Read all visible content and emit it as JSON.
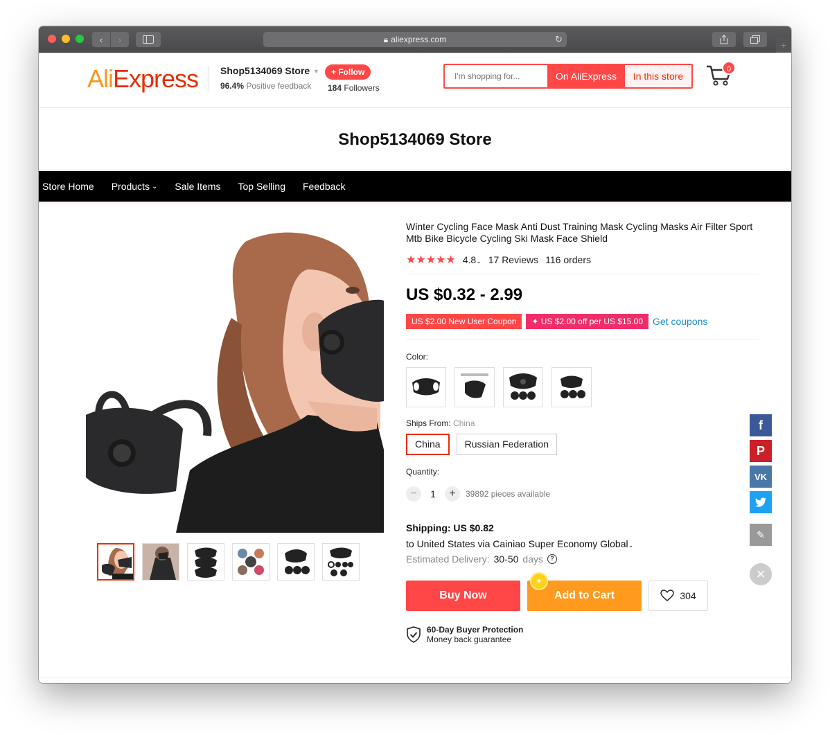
{
  "browser": {
    "url": "aliexpress.com"
  },
  "header": {
    "logo_ali": "Ali",
    "logo_express": "Express",
    "store_name": "Shop5134069 Store",
    "feedback_percent": "96.4%",
    "feedback_label": "Positive feedback",
    "follow_label": "+ Follow",
    "followers_count": "184",
    "followers_label": "Followers",
    "search_placeholder": "I'm shopping for...",
    "search_on_label": "On AliExpress",
    "search_store_label": "In this store",
    "cart_count": "0"
  },
  "banner": {
    "title": "Shop5134069 Store"
  },
  "store_nav": {
    "items": [
      "Store Home",
      "Products",
      "Sale Items",
      "Top Selling",
      "Feedback"
    ]
  },
  "product": {
    "title": "Winter Cycling Face Mask Anti Dust Training Mask Cycling Masks Air Filter Sport Mtb Bike Bicycle Cycling Ski Mask Face Shield",
    "stars": "★★★★★",
    "rating": "4.8",
    "reviews": "17 Reviews",
    "orders": "116 orders",
    "price": "US $0.32 - 2.99",
    "coupon_1": "US $2.00 New User Coupon",
    "coupon_2": "✦ US $2.00 off per US $15.00",
    "get_coupons": "Get coupons",
    "color_label": "Color:",
    "ships_from_label": "Ships From:",
    "ships_from_value": "China",
    "ship_options": [
      "China",
      "Russian Federation"
    ],
    "quantity_label": "Quantity:",
    "quantity_value": "1",
    "available": "39892 pieces available",
    "shipping": "Shipping: US $0.82",
    "ship_via": "to United States via Cainiao Super Economy Global",
    "delivery_label": "Estimated Delivery:",
    "delivery_value": "30-50",
    "delivery_unit": "days",
    "buy_now": "Buy Now",
    "add_to_cart": "Add to Cart",
    "wishlist_count": "304",
    "protection_title": "60-Day Buyer Protection",
    "protection_sub": "Money back guarantee"
  },
  "colors": {
    "brand_red": "#ff4747",
    "brand_orange": "#ff9a1e",
    "nav_bg": "#000000"
  }
}
